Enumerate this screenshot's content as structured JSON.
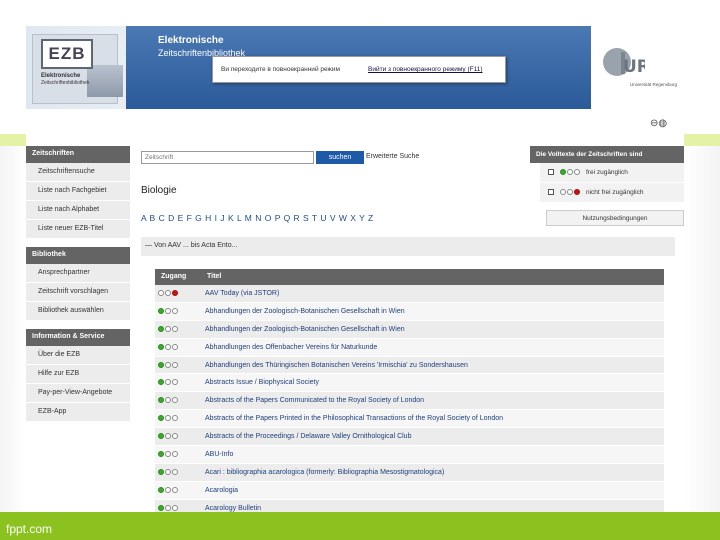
{
  "watermark": "fppt.com",
  "header": {
    "logo_text": "EZB",
    "logo_sub1": "Elektronische",
    "logo_sub2": "Zeitschriftenbibliothek",
    "site_title_line1": "Elektronische",
    "site_title_line2": "Zeitschriftenbibliothek",
    "popup_link_a": "Ви переходите в повноекранний режим",
    "popup_link_b": "Вийти з повноекранного режиму (F11)",
    "university_text": "Universität Regensburg"
  },
  "toolbar": {
    "icons": [
      "minus-circle-icon",
      "pause-circle-icon"
    ]
  },
  "sidebar": {
    "sections": [
      {
        "title": "Zeitschriften",
        "items": [
          "Zeitschriftensuche",
          "Liste nach Fachgebiet",
          "Liste nach Alphabet",
          "Liste neuer EZB-Titel"
        ]
      },
      {
        "title": "Bibliothek",
        "items": [
          "Ansprechpartner",
          "Zeitschrift vorschlagen",
          "Bibliothek auswählen"
        ]
      },
      {
        "title": "Information & Service",
        "items": [
          "Über die EZB",
          "Hilfe zur EZB",
          "Pay-per-View-Angebote",
          "EZB-App"
        ]
      }
    ]
  },
  "search": {
    "placeholder": "Zeitschrift",
    "button_label": "suchen",
    "advanced_label": "Erweiterte Suche"
  },
  "main": {
    "section_title": "Biologie",
    "alphabet": "A B C D E F G H I J K L M N O P Q R S T U V W X Y Z",
    "range_label": "— Von AAV ... bis Acta Ento..."
  },
  "table": {
    "col_access": "Zugang",
    "col_title": "Titel",
    "rows": [
      {
        "access": [
          "empty",
          "empty",
          "red"
        ],
        "title": "AAV Today (via JSTOR)"
      },
      {
        "access": [
          "green",
          "empty",
          "empty"
        ],
        "title": "Abhandlungen der Zoologisch-Botanischen Gesellschaft in Wien"
      },
      {
        "access": [
          "green",
          "empty",
          "empty"
        ],
        "title": "Abhandlungen der Zoologisch-Botanischen Gesellschaft in Wien"
      },
      {
        "access": [
          "green",
          "empty",
          "empty"
        ],
        "title": "Abhandlungen des Offenbacher Vereins für Naturkunde"
      },
      {
        "access": [
          "green",
          "empty",
          "empty"
        ],
        "title": "Abhandlungen des Thüringischen Botanischen Vereins 'Irmischia' zu Sondershausen"
      },
      {
        "access": [
          "green",
          "empty",
          "empty"
        ],
        "title": "Abstracts Issue / Biophysical Society"
      },
      {
        "access": [
          "green",
          "empty",
          "empty"
        ],
        "title": "Abstracts of the Papers Communicated to the Royal Society of London"
      },
      {
        "access": [
          "green",
          "empty",
          "empty"
        ],
        "title": "Abstracts of the Papers Printed in the Philosophical Transactions of the Royal Society of London"
      },
      {
        "access": [
          "green",
          "empty",
          "empty"
        ],
        "title": "Abstracts of the Proceedings / Delaware Valley Ornithological Club"
      },
      {
        "access": [
          "green",
          "empty",
          "empty"
        ],
        "title": "ABU-Info"
      },
      {
        "access": [
          "green",
          "empty",
          "empty"
        ],
        "title": "Acari : bibliographia acarologica (formerly: Bibliographia Mesostigmatologica)"
      },
      {
        "access": [
          "green",
          "empty",
          "empty"
        ],
        "title": "Acarologia"
      },
      {
        "access": [
          "green",
          "empty",
          "empty"
        ],
        "title": "Acarology Bulletin"
      }
    ]
  },
  "right_panel": {
    "title": "Die Volltexte der Zeitschriften sind",
    "legend": [
      {
        "dots": [
          "green",
          "empty",
          "empty"
        ],
        "label": "frei zugänglich"
      },
      {
        "dots": [
          "empty",
          "empty",
          "red"
        ],
        "label": "nicht frei zugänglich"
      }
    ],
    "button_label": "Nutzungsbedingungen"
  },
  "colors": {
    "header_blue": "#2b5a99",
    "sidebar_header": "#646464",
    "link_blue": "#1f3f7a",
    "fppt_green": "#8cc21f",
    "dot_green": "#3aaa2a",
    "dot_red": "#cc1111"
  }
}
